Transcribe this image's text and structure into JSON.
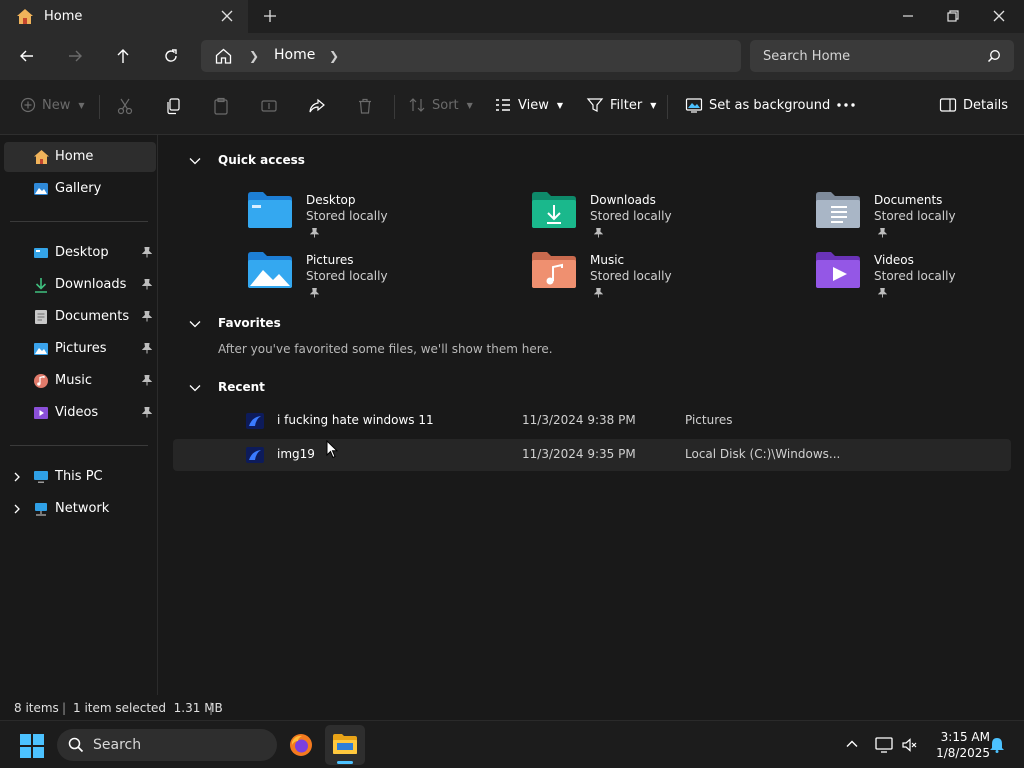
{
  "window": {
    "tab_title": "Home",
    "colors": {
      "accent": "#4cc2ff",
      "background": "#191919",
      "chrome": "#2b2b2b"
    }
  },
  "address": {
    "home_icon": "home-icon",
    "crumbs": [
      "Home"
    ]
  },
  "search": {
    "placeholder": "Search Home"
  },
  "toolbar": {
    "new_label": "New",
    "sort_label": "Sort",
    "view_label": "View",
    "filter_label": "Filter",
    "background_label": "Set as background",
    "details_label": "Details"
  },
  "sidebar": {
    "top": [
      {
        "label": "Home",
        "icon": "home-icon"
      },
      {
        "label": "Gallery",
        "icon": "gallery-icon"
      }
    ],
    "pinned": [
      {
        "label": "Desktop",
        "icon": "desktop-icon"
      },
      {
        "label": "Downloads",
        "icon": "download-icon"
      },
      {
        "label": "Documents",
        "icon": "document-icon"
      },
      {
        "label": "Pictures",
        "icon": "pictures-icon"
      },
      {
        "label": "Music",
        "icon": "music-icon"
      },
      {
        "label": "Videos",
        "icon": "videos-icon"
      }
    ],
    "bottom": [
      {
        "label": "This PC",
        "icon": "pc-icon"
      },
      {
        "label": "Network",
        "icon": "network-icon"
      }
    ]
  },
  "quick_access": {
    "title": "Quick access",
    "items": [
      {
        "name": "Desktop",
        "status": "Stored locally",
        "icon": "desktop-folder-icon"
      },
      {
        "name": "Downloads",
        "status": "Stored locally",
        "icon": "downloads-folder-icon"
      },
      {
        "name": "Documents",
        "status": "Stored locally",
        "icon": "documents-folder-icon"
      },
      {
        "name": "Pictures",
        "status": "Stored locally",
        "icon": "pictures-folder-icon"
      },
      {
        "name": "Music",
        "status": "Stored locally",
        "icon": "music-folder-icon"
      },
      {
        "name": "Videos",
        "status": "Stored locally",
        "icon": "videos-folder-icon"
      }
    ]
  },
  "favorites": {
    "title": "Favorites",
    "empty_text": "After you've favorited some files, we'll show them here."
  },
  "recent": {
    "title": "Recent",
    "items": [
      {
        "name": "i fucking hate windows 11",
        "date": "11/3/2024 9:38 PM",
        "location": "Pictures"
      },
      {
        "name": "img19",
        "date": "11/3/2024 9:35 PM",
        "location": "Local Disk (C:)\\Windows..."
      }
    ]
  },
  "status": {
    "items": "8 items",
    "selection": "1 item selected  1.31 MB"
  },
  "taskbar": {
    "search_label": "Search",
    "time": "3:15 AM",
    "date": "1/8/2025"
  }
}
